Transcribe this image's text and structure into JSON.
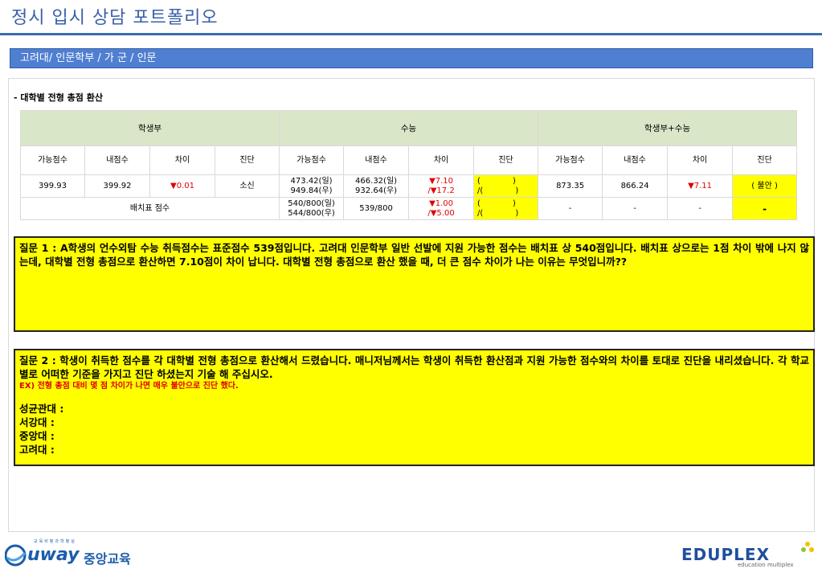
{
  "header": {
    "title": "정시 입시 상담 포트폴리오",
    "subtitle": "고려대/ 인문학부 / 가 군 / 인문"
  },
  "section_label": "- 대학별 전형 총점 환산",
  "table": {
    "groups": [
      "학생부",
      "수능",
      "학생부+수능"
    ],
    "columns": [
      "가능점수",
      "내점수",
      "차이",
      "진단",
      "가능점수",
      "내점수",
      "차이",
      "진단",
      "가능점수",
      "내점수",
      "차이",
      "진단"
    ],
    "row1": {
      "s_possible": "399.93",
      "s_mine": "399.92",
      "s_diff": "▼0.01",
      "s_diag": "소신",
      "c_possible_1": "473.42(일)",
      "c_possible_2": "949.84(우)",
      "c_mine_1": "466.32(일)",
      "c_mine_2": "932.64(우)",
      "c_diff_1": "▼7.10",
      "c_diff_2": "/▼17.2",
      "c_diag_1": "(　　　　)",
      "c_diag_2": "/(　　　　)",
      "t_possible": "873.35",
      "t_mine": "866.24",
      "t_diff": "▼7.11",
      "t_diag": "( 불안 )"
    },
    "row2": {
      "label": "배치표 점수",
      "c_possible_1": "540/800(일)",
      "c_possible_2": "544/800(우)",
      "c_mine": "539/800",
      "c_diff_1": "▼1.00",
      "c_diff_2": "/▼5.00",
      "c_diag_1": "(　　　　)",
      "c_diag_2": "/(　　　　)",
      "t_possible": "-",
      "t_mine": "-",
      "t_diff": "-",
      "t_diag": "-"
    }
  },
  "question1": {
    "text": "질문 1 : A학생의 언수외탐 수능 취득점수는 표준점수 539점입니다. 고려대 인문학부 일반 선발에 지원 가능한 점수는 배치표 상 540점입니다. 배치표 상으로는 1점 차이 밖에 나지 않는데, 대학별 전형 총점으로 환산하면 7.10점이 차이 납니다. 대학별 전형 총점으로 환산 했을 때, 더 큰 점수 차이가 나는 이유는 무엇입니까??"
  },
  "question2": {
    "text": "질문 2 : 학생이 취득한 점수를 각 대학별 전형 총점으로 환산해서 드렸습니다. 매니저님께서는 학생이 취득한 환산점과 지원 가능한 점수와의 차이를 토대로 진단을 내리셨습니다. 각 학교별로 어떠한 기준을 가지고 진단 하셨는지 기술 해 주십시오.",
    "example": "EX) 전형 총점 대비 몇 점 차이가 나면 매우 불안으로 진단 했다.",
    "schools": [
      "성균관대 :",
      "서강대 :",
      "중앙대 :",
      "고려대 :"
    ]
  },
  "footer": {
    "left_small": "교육비평과학평실",
    "left_brand": "uway",
    "left_brand_ko": "중앙교육",
    "right_brand": "EDUPLEX",
    "right_sub": "education multiplex"
  },
  "colors": {
    "accent_blue": "#3e6bb0",
    "subhead_bg": "#4f7fd1",
    "header_green": "#d9e6c7",
    "highlight_yellow": "#ffff00",
    "down_red": "#e00000"
  }
}
